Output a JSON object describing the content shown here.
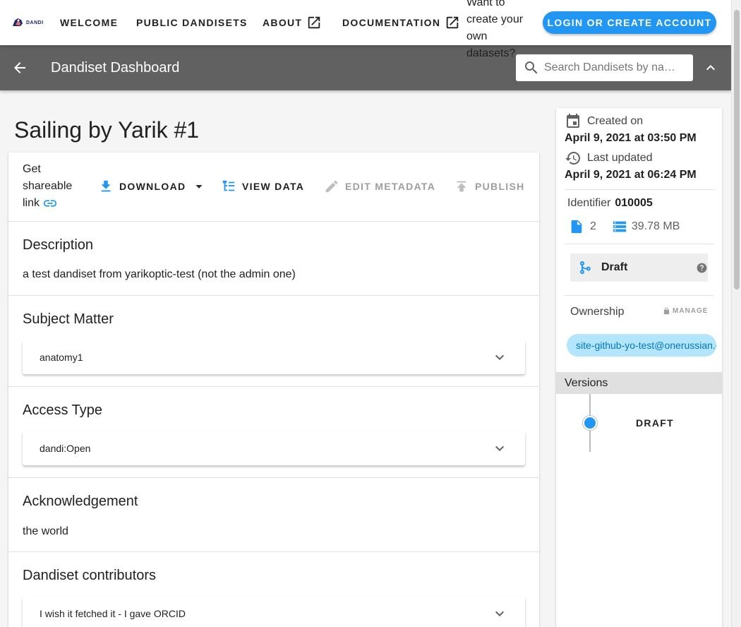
{
  "topnav": {
    "logo_text": "DANDI",
    "links": [
      {
        "label": "WELCOME"
      },
      {
        "label": "PUBLIC DANDISETS"
      },
      {
        "label": "ABOUT"
      },
      {
        "label": "DOCUMENTATION"
      }
    ],
    "promo": "Want to create your own datasets?",
    "login_label": "LOGIN OR CREATE ACCOUNT"
  },
  "appbar": {
    "title": "Dandiset Dashboard",
    "search_placeholder": "Search Dandisets by na…"
  },
  "dandiset": {
    "title": "Sailing by Yarik #1",
    "share_label": "Get shareable link",
    "actions": {
      "download": "DOWNLOAD",
      "view_data": "VIEW DATA",
      "edit_metadata": "EDIT METADATA",
      "publish": "PUBLISH"
    },
    "sections": {
      "description": {
        "heading": "Description",
        "text": "a test dandiset from yarikoptic-test (not the admin one)"
      },
      "subject_matter": {
        "heading": "Subject Matter",
        "value": "anatomy1"
      },
      "access_type": {
        "heading": "Access Type",
        "value": "dandi:Open"
      },
      "acknowledgement": {
        "heading": "Acknowledgement",
        "text": "the world"
      },
      "contributors": {
        "heading": "Dandiset contributors",
        "value": "I wish it fetched it - I gave ORCID"
      }
    }
  },
  "sidebar": {
    "created_label": "Created on",
    "created_value": "April 9, 2021 at 03:50 PM",
    "updated_label": "Last updated",
    "updated_value": "April 9, 2021 at 06:24 PM",
    "identifier_label": "Identifier",
    "identifier_value": "010005",
    "file_count": "2",
    "size": "39.78 MB",
    "status": "Draft",
    "ownership_label": "Ownership",
    "manage_label": "MANAGE",
    "owner": "site-github-yo-test@onerussian.com",
    "versions_label": "Versions",
    "version": "DRAFT"
  },
  "colors": {
    "primary": "#2196f3",
    "appbar": "#616161",
    "chip": "#b3e5fc"
  }
}
